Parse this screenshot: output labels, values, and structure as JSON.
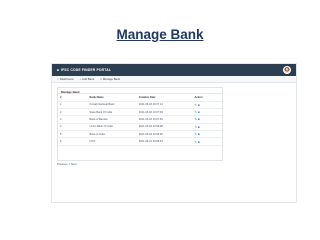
{
  "slide": {
    "title": "Manage Bank"
  },
  "app": {
    "brand": "IFSC CODE FINDER PORTAL"
  },
  "nav": [
    {
      "label": "Dashboard",
      "icon": "home-icon"
    },
    {
      "label": "Add Bank",
      "icon": "plus-icon"
    },
    {
      "label": "Manage Bank",
      "icon": "list-icon"
    }
  ],
  "panel": {
    "heading": "Manage Bank"
  },
  "table": {
    "headers": [
      "#",
      "Bank Name",
      "Creation Date",
      "Action"
    ],
    "rows": [
      {
        "num": "1",
        "name": "Punjab National Bank",
        "date": "2021-06-18 10:07:14"
      },
      {
        "num": "2",
        "name": "State Bank Of India",
        "date": "2021-06-18 10:07:39"
      },
      {
        "num": "3",
        "name": "Bank of Baroda",
        "date": "2021-06-18 10:07:52"
      },
      {
        "num": "4",
        "name": "Union Bank Of India",
        "date": "2021-06-18 10:08:08"
      },
      {
        "num": "5",
        "name": "Bank of India",
        "date": "2021-06-18 10:08:25"
      },
      {
        "num": "6",
        "name": "UCO",
        "date": "2021-06-21 10:08:43"
      }
    ]
  },
  "pager": {
    "prev": "Previous",
    "page": "1",
    "next": "Next"
  }
}
